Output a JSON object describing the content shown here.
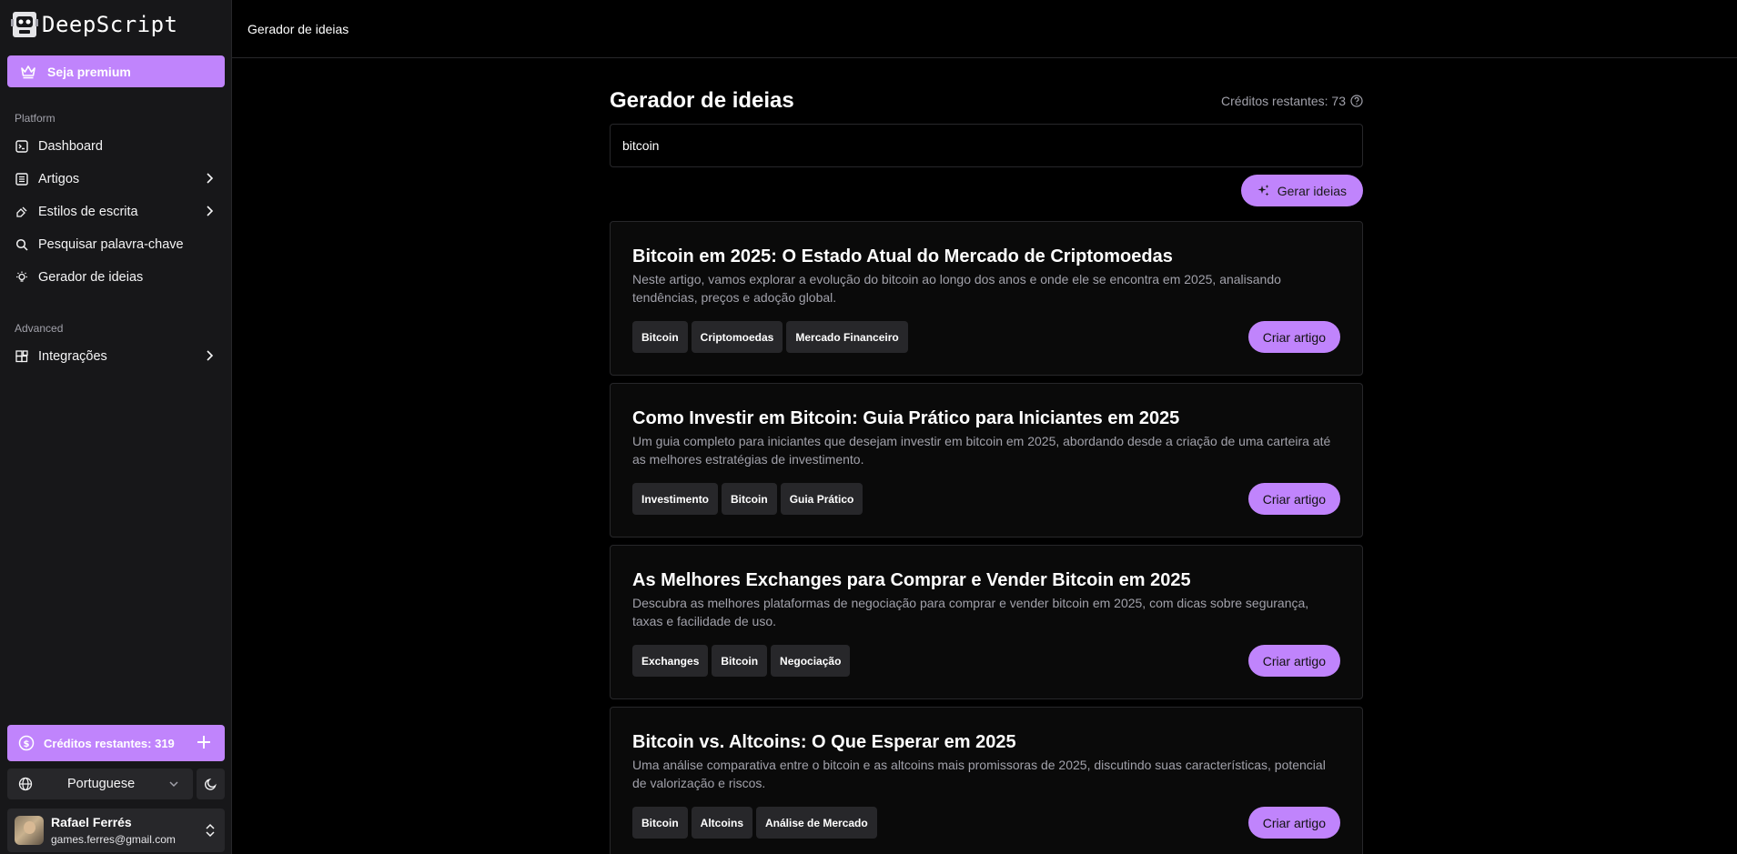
{
  "app": {
    "name": "DeepScript"
  },
  "sidebar": {
    "premium_label": "Seja premium",
    "platform_label": "Platform",
    "platform_items": [
      {
        "label": "Dashboard",
        "icon": "terminal-icon"
      },
      {
        "label": "Artigos",
        "icon": "list-icon"
      },
      {
        "label": "Estilos de escrita",
        "icon": "pen-icon"
      },
      {
        "label": "Pesquisar palavra-chave",
        "icon": "search-icon"
      },
      {
        "label": "Gerador de ideias",
        "icon": "lightbulb-icon"
      }
    ],
    "advanced_label": "Advanced",
    "advanced_items": [
      {
        "label": "Integrações",
        "icon": "blocks-icon"
      }
    ],
    "credits_label": "Créditos restantes: 319",
    "language": "Portuguese",
    "user": {
      "name": "Rafael Ferrés",
      "email": "games.ferres@gmail.com"
    }
  },
  "header": {
    "breadcrumb": "Gerador de ideias"
  },
  "main": {
    "title": "Gerador de ideias",
    "credits_remaining": "Créditos restantes: 73",
    "search_value": "bitcoin",
    "generate_label": "Gerar ideias",
    "cards": [
      {
        "title": "Bitcoin em 2025: O Estado Atual do Mercado de Criptomoedas",
        "description": "Neste artigo, vamos explorar a evolução do bitcoin ao longo dos anos e onde ele se encontra em 2025, analisando tendências, preços e adoção global.",
        "tags": [
          "Bitcoin",
          "Criptomoedas",
          "Mercado Financeiro"
        ],
        "button": "Criar artigo"
      },
      {
        "title": "Como Investir em Bitcoin: Guia Prático para Iniciantes em 2025",
        "description": "Um guia completo para iniciantes que desejam investir em bitcoin em 2025, abordando desde a criação de uma carteira até as melhores estratégias de investimento.",
        "tags": [
          "Investimento",
          "Bitcoin",
          "Guia Prático"
        ],
        "button": "Criar artigo"
      },
      {
        "title": "As Melhores Exchanges para Comprar e Vender Bitcoin em 2025",
        "description": "Descubra as melhores plataformas de negociação para comprar e vender bitcoin em 2025, com dicas sobre segurança, taxas e facilidade de uso.",
        "tags": [
          "Exchanges",
          "Bitcoin",
          "Negociação"
        ],
        "button": "Criar artigo"
      },
      {
        "title": "Bitcoin vs. Altcoins: O Que Esperar em 2025",
        "description": "Uma análise comparativa entre o bitcoin e as altcoins mais promissoras de 2025, discutindo suas características, potencial de valorização e riscos.",
        "tags": [
          "Bitcoin",
          "Altcoins",
          "Análise de Mercado"
        ],
        "button": "Criar artigo"
      }
    ]
  },
  "colors": {
    "accent": "#c084fc",
    "sidebar_bg": "#171719",
    "border": "#27272a",
    "muted_text": "#a1a1aa"
  }
}
